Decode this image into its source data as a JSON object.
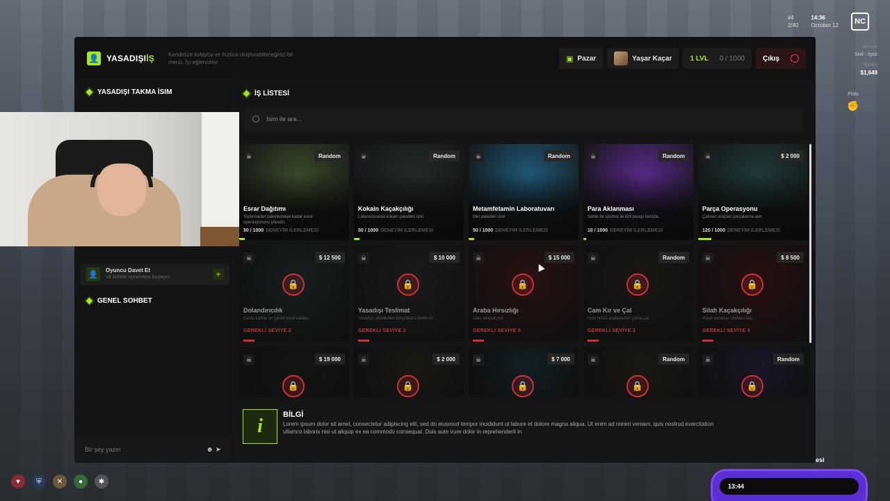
{
  "hud": {
    "players_id": "#4",
    "players_count": "2/40",
    "time": "14:36",
    "date": "October 12",
    "logo": "NC",
    "job_label": "Meslek",
    "job_value": "Sivil - İşsiz",
    "bank_label": "Banka",
    "money": "$1,649",
    "weapon": "Fists"
  },
  "header": {
    "title_prefix": "YASADIŞI",
    "title_accent": "İŞ",
    "description": "Kendinize kolayca ve hızlıca oluşturabileceğiniz bir menü. İyi eğlenceler",
    "market_label": "Pazar",
    "user_name": "Yaşar Kaçar",
    "level": "1 LVL",
    "xp": "0 / 1000",
    "exit_label": "Çıkış"
  },
  "sidebar": {
    "nickname_title": "YASADIŞI TAKMA İSIM",
    "invite_title": "Oyuncu Davet Et",
    "invite_sub": "Ve birlikte oynamaya başlayın",
    "chat_title": "GENEL SOHBET",
    "chat_placeholder": "Bir şey yazın"
  },
  "jobs": {
    "title": "İŞ LİSTESİ",
    "search_placeholder": "İsim ile ara...",
    "progress_label": "DENEYİM İLERLEMESİ",
    "items": [
      {
        "name": "Esrar Dağıtımı",
        "desc": "Toplamadan paketlemeye kadar esrar operasyonunu yönetin.",
        "tag": "Random",
        "progress": "50 / 1000",
        "progress_value": 0.05,
        "locked": false,
        "color": "#3a4a2a"
      },
      {
        "name": "Kokain Kaçakçılığı",
        "desc": "Laboratuvarda kokain paketleri üret",
        "tag": "Random",
        "progress": "50 / 1000",
        "progress_value": 0.05,
        "locked": false,
        "color": "#232a2a"
      },
      {
        "name": "Metamfetamin Laboratuvarı",
        "desc": "Met paketleri üret",
        "tag": "Random",
        "progress": "50 / 1000",
        "progress_value": 0.05,
        "locked": false,
        "color": "#1f5a7a"
      },
      {
        "name": "Para Aklanması",
        "desc": "Sahte bir işletme ile kirli parayı temizle.",
        "tag": "Random",
        "progress": "10 / 1000",
        "progress_value": 0.01,
        "locked": false,
        "color": "#5a2a8a"
      },
      {
        "name": "Parça Operasyonu",
        "desc": "Çalınan araçları parçalarına ayır.",
        "tag": "$ 2 000",
        "progress": "120 / 1000",
        "progress_value": 0.12,
        "locked": false,
        "color": "#1f3a3a"
      },
      {
        "name": "Dolandırıcılık",
        "desc": "Sahte kartlar ve çalıntı kredi kartları.",
        "tag": "$ 12 500",
        "req": "GEREKLİ SEVİYE 2",
        "locked": true,
        "color": "#2a4a4a"
      },
      {
        "name": "Yasadışı Teslimat",
        "desc": "Yasadışı gönderileri karşılıklara teslim et",
        "tag": "$ 10 000",
        "req": "GEREKLİ SEVİYE 2",
        "locked": true,
        "color": "#3a3a3a"
      },
      {
        "name": "Araba Hırsızlığı",
        "desc": "Lüks araçları çal",
        "tag": "$ 15 000",
        "req": "GEREKLİ SEVİYE 3",
        "locked": true,
        "color": "#6a1a1a"
      },
      {
        "name": "Cam Kır ve Çal",
        "desc": "Hızlı tırtıklı arabalardan çanta çal.",
        "tag": "Random",
        "req": "GEREKLİ SEVİYE 3",
        "locked": true,
        "color": "#3a2e22"
      },
      {
        "name": "Silah Kaçakçılığı",
        "desc": "Ateşli yasadışı silahları taşı.",
        "tag": "$ 8 500",
        "req": "GEREKLİ SEVİYE 3",
        "locked": true,
        "color": "#6a1418"
      },
      {
        "name": "",
        "desc": "",
        "tag": "$ 19 000",
        "locked": true,
        "color": "#2a2222"
      },
      {
        "name": "",
        "desc": "",
        "tag": "$ 2 000",
        "locked": true,
        "color": "#3a3420"
      },
      {
        "name": "",
        "desc": "",
        "tag": "$ 7 000",
        "locked": true,
        "color": "#1a4a5a"
      },
      {
        "name": "",
        "desc": "",
        "tag": "Random",
        "locked": true,
        "color": "#3a3422"
      },
      {
        "name": "",
        "desc": "",
        "tag": "Random",
        "locked": true,
        "color": "#3a2a6a"
      }
    ]
  },
  "info": {
    "title": "BİLGİ",
    "icon": "i",
    "text": "Lorem ipsum dolor sit amet, consectetur adipiscing elit, sed do eiusmod tempor incididunt ut labore et dolore magna aliqua. Ut enim ad minim veniam, quis nostrud exercitation ullamco laboris nisi ut aliquip ex ea commodo consequat. Duis aute irure dolor in reprehenderit in"
  },
  "phone": {
    "time": "13:44"
  },
  "bottom_text": "esi",
  "colors": {
    "accent": "#a8e61d",
    "danger": "#c9333b",
    "panel": "#151515"
  }
}
